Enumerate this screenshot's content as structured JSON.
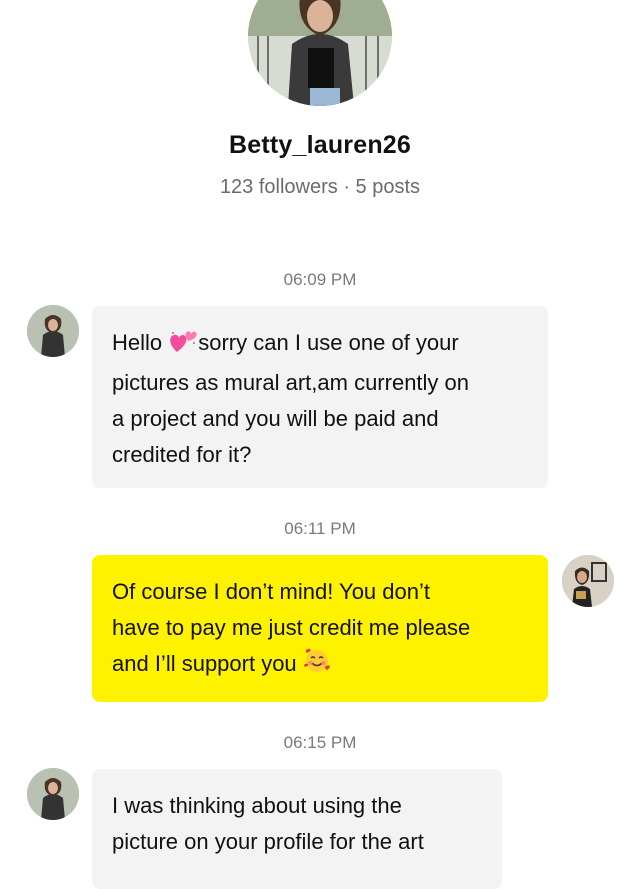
{
  "profile": {
    "username": "Betty_lauren26",
    "stats": "123 followers · 5 posts"
  },
  "messages": [
    {
      "time": "06:09 PM",
      "sender": "incoming",
      "lines": [
        [
          "Hello ",
          "emoji-hearts",
          "sorry can I use one of your"
        ],
        [
          "pictures as mural art,am currently on"
        ],
        [
          "a project and you will be paid and"
        ],
        [
          "credited for it?"
        ]
      ]
    },
    {
      "time": "06:11 PM",
      "sender": "outgoing",
      "lines": [
        [
          "Of course I don’t mind! You don’t"
        ],
        [
          "have to pay me just credit me please"
        ],
        [
          "and I’ll support you ",
          "emoji-smiling-hearts"
        ]
      ]
    },
    {
      "time": "06:15 PM",
      "sender": "incoming",
      "lines": [
        [
          "I was thinking about using the"
        ],
        [
          "picture on your profile for the art"
        ]
      ]
    }
  ],
  "colors": {
    "outgoing_bubble": "#fff200",
    "incoming_bubble": "#f3f3f3",
    "timestamp": "#7a7a7a"
  }
}
